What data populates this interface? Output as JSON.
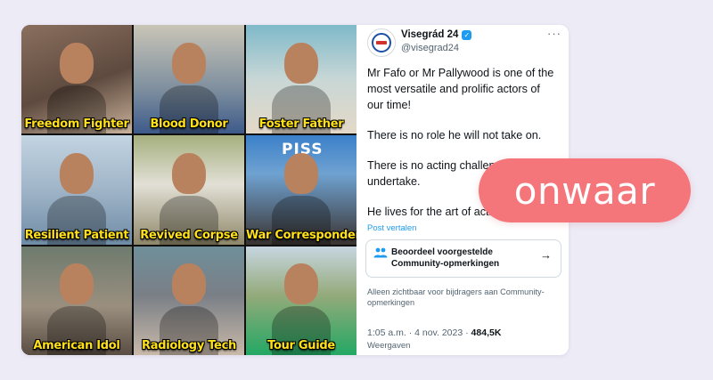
{
  "image_grid": {
    "tiles": [
      {
        "caption": "Freedom Fighter"
      },
      {
        "caption": "Blood Donor"
      },
      {
        "caption": "Foster Father"
      },
      {
        "caption": "Resilient Patient"
      },
      {
        "caption": "Revived Corpse"
      },
      {
        "caption": "War Correspondent",
        "overlay_text": "PISS"
      },
      {
        "caption": "American Idol"
      },
      {
        "caption": "Radiology Tech"
      },
      {
        "caption": "Tour Guide"
      }
    ]
  },
  "tweet": {
    "author_name": "Visegrád 24",
    "handle": "@visegrad24",
    "verified_icon": "verified-badge-icon",
    "more_icon": "more-options-icon",
    "paragraphs": [
      [
        "Mr Fafo or Mr Pallywood is one of the",
        "most versatile and prolific actors of",
        "our time!"
      ],
      [
        "There is no role he will not take on."
      ],
      [
        "There is no acting challenge he will not",
        "undertake."
      ],
      [
        "He lives for the art of acting."
      ]
    ],
    "translate_link": "Post vertalen",
    "community_notes": {
      "icon": "people-icon",
      "label": "Beoordeel voorgestelde Community-opmerkingen",
      "arrow_icon": "arrow-right-icon",
      "visibility_note": "Alleen zichtbaar voor bijdragers aan Community-opmerkingen"
    },
    "timestamp": "1:05 a.m. · 4 nov. 2023 ·",
    "view_count": "484,5K",
    "views_label": "Weergaven"
  },
  "verdict_stamp": {
    "label": "onwaar",
    "color": "#f5767a"
  },
  "colors": {
    "background": "#ecebf6",
    "caption_yellow": "#ffe11a",
    "link_blue": "#1d9bf0"
  }
}
